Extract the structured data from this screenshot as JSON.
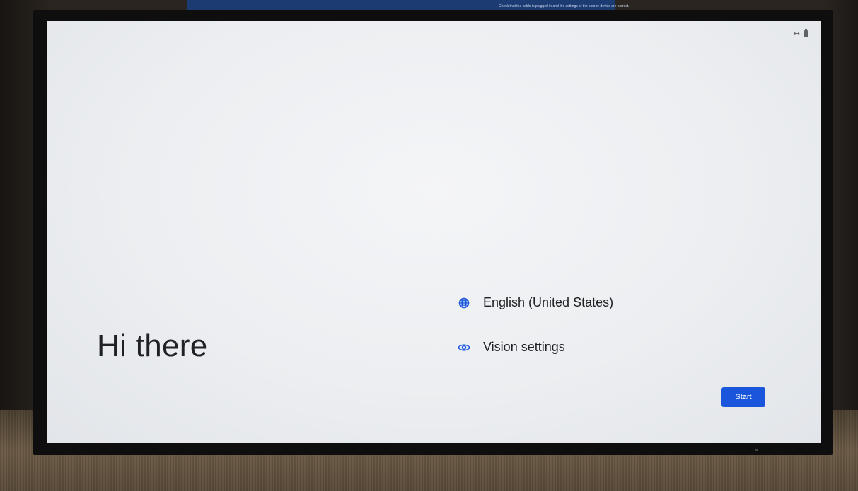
{
  "background_monitor": {
    "text": "Check that the cable is plugged in and the settings of the source device are correct."
  },
  "screen": {
    "status_icons": [
      "swap-horizontal-icon",
      "battery-icon"
    ],
    "greeting": "Hi there",
    "options": [
      {
        "icon": "globe-icon",
        "label": "English (United States)"
      },
      {
        "icon": "eye-icon",
        "label": "Vision settings"
      }
    ],
    "start_label": "Start",
    "accent_color": "#1a56db",
    "text_color": "#202124"
  }
}
